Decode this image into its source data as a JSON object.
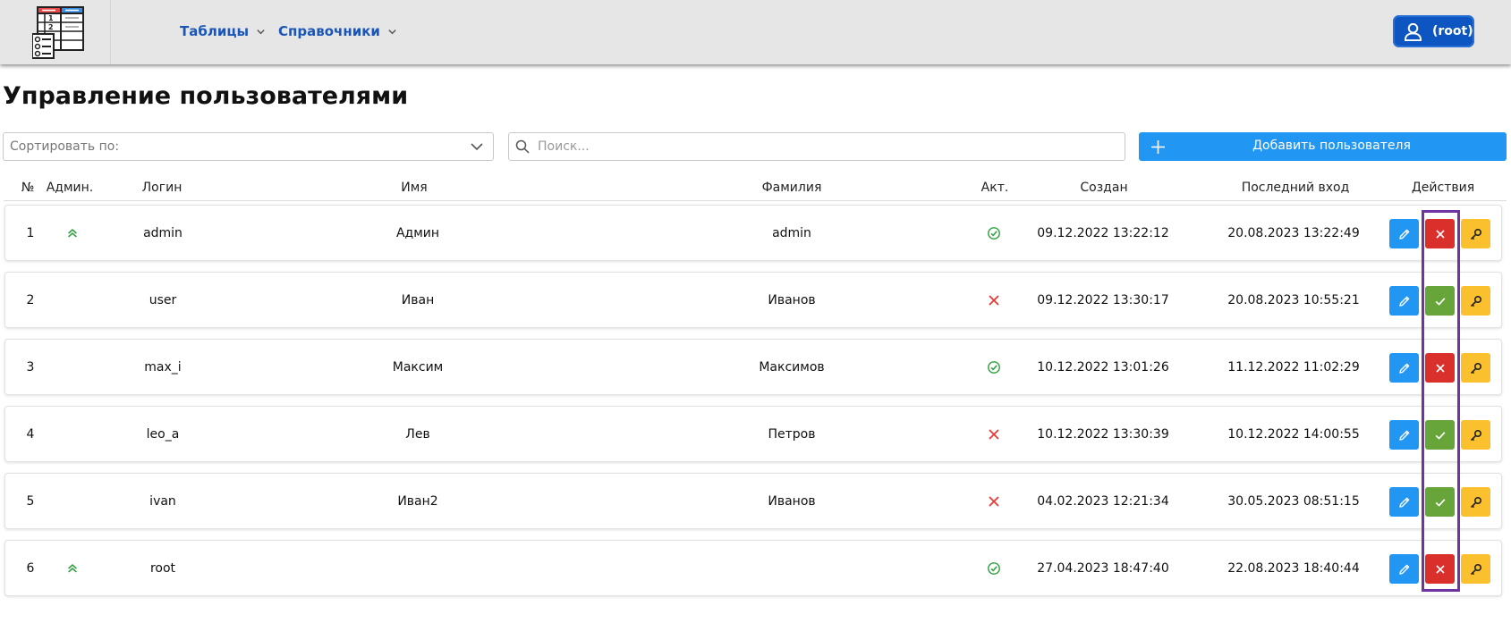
{
  "nav": {
    "tables": "Таблицы",
    "directories": "Справочники"
  },
  "user": {
    "label": "(root)"
  },
  "page_title": "Управление пользователями",
  "sort": {
    "placeholder": "Сортировать по:"
  },
  "search": {
    "placeholder": "Поиск..."
  },
  "add_button": "Добавить пользователя",
  "columns": [
    "№",
    "Админ.",
    "Логин",
    "Имя",
    "Фамилия",
    "Акт.",
    "Создан",
    "Последний вход",
    "Действия"
  ],
  "colors": {
    "edit": "#2196f3",
    "deactivate": "#d9302c",
    "activate": "#67a53a",
    "password": "#fbc02d",
    "active_icon": "#2e9e3e",
    "inactive_icon": "#e53935",
    "admin_icon": "#2e9e3e",
    "highlight": "#6f34a0"
  },
  "rows": [
    {
      "num": "1",
      "admin": true,
      "login": "admin",
      "name": "Админ",
      "surname": "admin",
      "active": true,
      "created": "09.12.2022 13:22:12",
      "last_login": "20.08.2023 13:22:49"
    },
    {
      "num": "2",
      "admin": false,
      "login": "user",
      "name": "Иван",
      "surname": "Иванов",
      "active": false,
      "created": "09.12.2022 13:30:17",
      "last_login": "20.08.2023 10:55:21"
    },
    {
      "num": "3",
      "admin": false,
      "login": "max_i",
      "name": "Максим",
      "surname": "Максимов",
      "active": true,
      "created": "10.12.2022 13:01:26",
      "last_login": "11.12.2022 11:02:29"
    },
    {
      "num": "4",
      "admin": false,
      "login": "leo_a",
      "name": "Лев",
      "surname": "Петров",
      "active": false,
      "created": "10.12.2022 13:30:39",
      "last_login": "10.12.2022 14:00:55"
    },
    {
      "num": "5",
      "admin": false,
      "login": "ivan",
      "name": "Иван2",
      "surname": "Иванов",
      "active": false,
      "created": "04.02.2023 12:21:34",
      "last_login": "30.05.2023 08:51:15"
    },
    {
      "num": "6",
      "admin": true,
      "login": "root",
      "name": "",
      "surname": "",
      "active": true,
      "created": "27.04.2023 18:47:40",
      "last_login": "22.08.2023 18:40:44"
    }
  ]
}
